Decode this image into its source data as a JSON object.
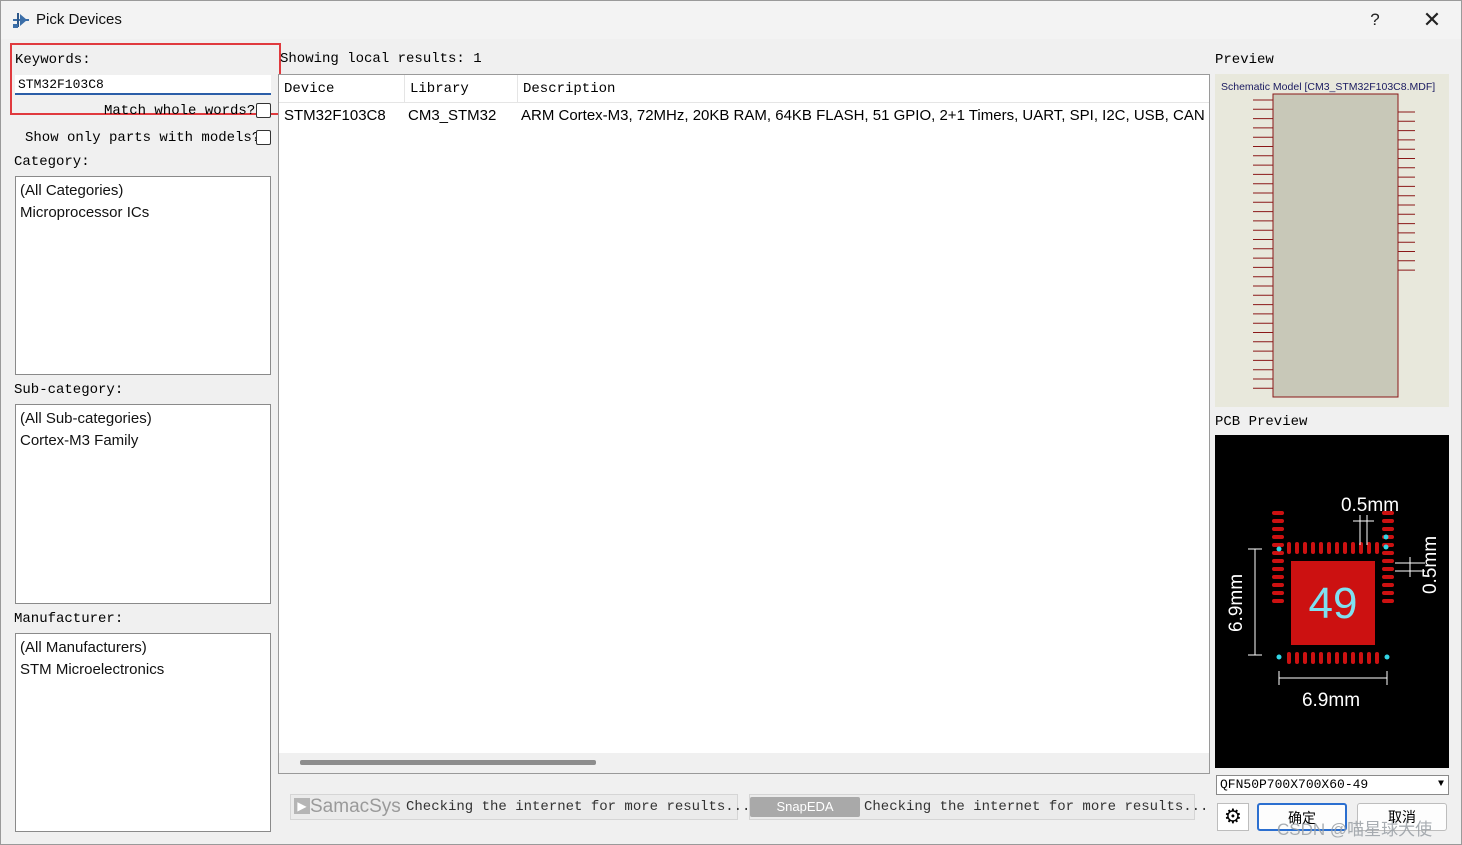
{
  "window": {
    "title": "Pick Devices",
    "help_label": "?",
    "close_label": "✕"
  },
  "left": {
    "keywords_label": "Keywords:",
    "keywords_value": "STM32F103C8",
    "match_whole_words_label": "Match whole words?",
    "show_only_models_label": "Show only parts with models?",
    "category_label": "Category:",
    "categories": [
      "(All Categories)",
      "Microprocessor ICs"
    ],
    "subcategory_label": "Sub-category:",
    "subcategories": [
      "(All Sub-categories)",
      "Cortex-M3 Family"
    ],
    "manufacturer_label": "Manufacturer:",
    "manufacturers": [
      "(All Manufacturers)",
      "STM Microelectronics"
    ]
  },
  "results": {
    "label": "Showing local results: 1",
    "columns": [
      "Device",
      "Library",
      "Description"
    ],
    "rows": [
      {
        "device": "STM32F103C8",
        "library": "CM3_STM32",
        "description": "ARM Cortex-M3, 72MHz, 20KB RAM, 64KB FLASH, 51 GPIO, 2+1 Timers, UART, SPI, I2C, USB, CAN"
      }
    ]
  },
  "online": {
    "samacsys_logo": "SamacSys",
    "samacsys_status": "Checking the internet for more results...",
    "snapeda_logo": "SnapEDA",
    "snapeda_status": "Checking the internet for more results..."
  },
  "preview": {
    "label": "Preview",
    "schematic_title": "Schematic Model [CM3_STM32F103C8.MDF]",
    "pcb_label": "PCB Preview",
    "pcb_pad_count": "49",
    "pcb_pitch_top": "0.5mm",
    "pcb_pitch_right": "0.5mm",
    "pcb_size_bottom": "6.9mm",
    "pcb_size_left": "6.9mm",
    "package": "QFN50P700X700X60-49"
  },
  "buttons": {
    "ok_label": "确定",
    "cancel_label": "取消"
  },
  "watermark": "CSDN @喵星球大使",
  "colors": {
    "highlight_border": "#e03a3e",
    "pcb_pad": "#cc1111",
    "pcb_dim": "#ffffff",
    "pcb_marker": "#33d6e6"
  }
}
